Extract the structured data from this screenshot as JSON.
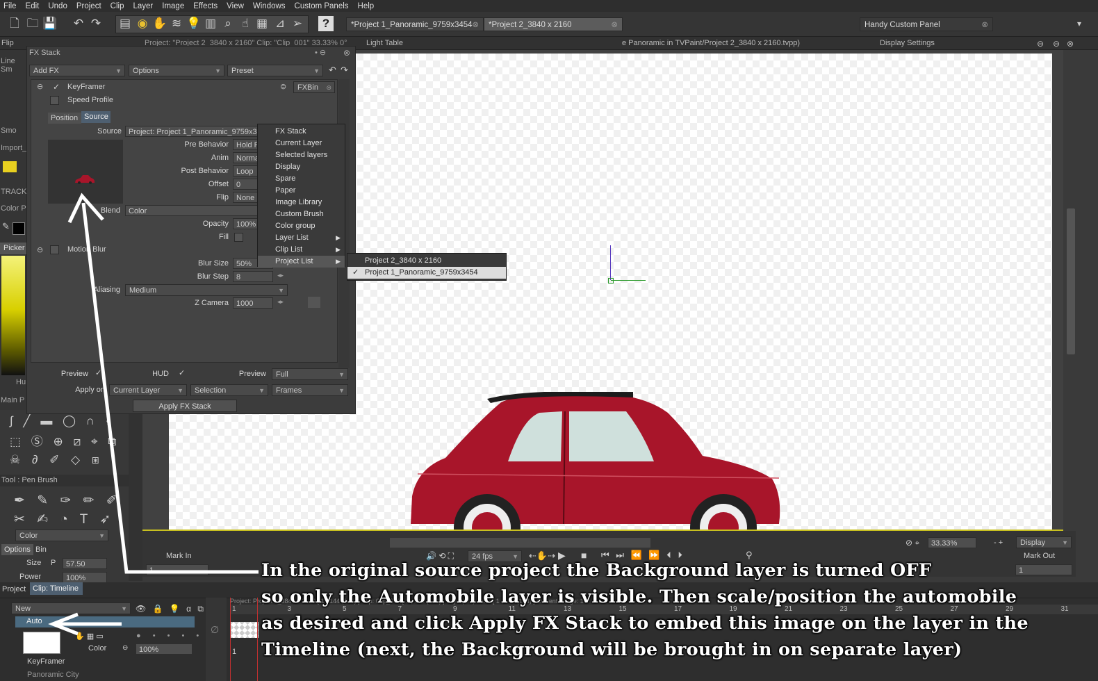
{
  "menu": [
    "File",
    "Edit",
    "Undo",
    "Project",
    "Clip",
    "Layer",
    "Image",
    "Effects",
    "View",
    "Windows",
    "Custom Panels",
    "Help"
  ],
  "tabs": [
    {
      "label": "*Project 1_Panoramic_9759x3454"
    },
    {
      "label": "*Project 2_3840 x 2160"
    }
  ],
  "handy_panel": "Handy Custom Panel",
  "panelbar": {
    "flip": "Flip",
    "project_info": "Project: \"Project 2_3840 x 2160\" Clip: \"Clip_001\" 33.33% 0°",
    "light_table": "Light Table",
    "path": "e Panoramic in TVPaint/Project 2_3840 x 2160.tvpp)",
    "display_settings": "Display Settings"
  },
  "left_labels": [
    "Line Sm",
    "Smo",
    "Import_",
    "TRACK",
    "Color P",
    "Picker",
    "Hu",
    "Main P"
  ],
  "fx_stack": {
    "title": "FX Stack",
    "add_fx": "Add FX",
    "options": "Options",
    "preset": "Preset",
    "keyframer": "KeyFramer",
    "fxbin": "FXBin",
    "speed_profile": "Speed Profile",
    "tab_position": "Position",
    "tab_source": "Source",
    "source_label": "Source",
    "source_value": "Project: Project 1_Panoramic_9759x3",
    "pre_behavior_label": "Pre Behavior",
    "pre_behavior_value": "Hold F",
    "anim_label": "Anim",
    "anim_value": "Norma",
    "post_behavior_label": "Post Behavior",
    "post_behavior_value": "Loop",
    "offset_label": "Offset",
    "offset_value": "0",
    "flip_label": "Flip",
    "flip_value": "None",
    "blend_label": "Blend",
    "blend_value": "Color",
    "opacity_label": "Opacity",
    "opacity_value": "100%",
    "fill_label": "Fill",
    "motion_blur": "Motion Blur",
    "blur_size_label": "Blur Size",
    "blur_size_value": "50%",
    "blur_step_label": "Blur Step",
    "blur_step_value": "8",
    "aliasing_label": "Aliasing",
    "aliasing_value": "Medium",
    "zcamera_label": "Z Camera",
    "zcamera_value": "1000",
    "preview_label": "Preview",
    "hud_label": "HUD",
    "preview2_label": "Preview",
    "preview2_value": "Full",
    "apply_on_label": "Apply on",
    "apply_on_value": "Current Layer",
    "selection_value": "Selection",
    "frames_value": "Frames",
    "apply_button": "Apply FX Stack"
  },
  "context_menu": [
    "FX Stack",
    "Current Layer",
    "Selected layers",
    "Display",
    "Spare",
    "Paper",
    "Image Library",
    "Custom Brush",
    "Color group",
    "Layer List",
    "Clip List",
    "Project List"
  ],
  "submenu": [
    "Project 2_3840 x 2160",
    "Project 1_Panoramic_9759x3454"
  ],
  "tool_panel": {
    "title": "Tool : Pen Brush",
    "color": "Color",
    "options_tab": "Options",
    "bin_tab": "Bin",
    "size_label": "Size",
    "size_p": "P",
    "size_value": "57.50",
    "power_label": "Power",
    "power_value": "100%"
  },
  "transport": {
    "mark_in": "Mark In",
    "mark_out": "Mark Out",
    "fps": "24 fps",
    "zoom": "33.33%",
    "display": "Display",
    "mark_out_value": "1",
    "mark_in_value": "1"
  },
  "timeline": {
    "project_tab": "Project",
    "clip_tab": "Clip: Timeline",
    "new_label": "New",
    "layer_mode": "Auto",
    "layer_name": "KeyFramer",
    "color_label": "Color",
    "opacity_value": "100%",
    "next_layer": "Panoramic City",
    "frame_numbers": [
      "1",
      "3",
      "5",
      "7",
      "9",
      "11",
      "13",
      "15",
      "17",
      "19",
      "21",
      "23",
      "25",
      "27",
      "29",
      "31"
    ],
    "status": "Project: Project 2_3840 x 2160 [ 1 , 144 (144) ]     Clip: Clip_001 [ 1 , 144 (144) ]     Layer(1/2): Auto [ 1 , 144 (144) ]     Current Image: 1"
  },
  "annotation": [
    "In the original source project the Background layer is turned OFF",
    "so only the Automobile layer is visible. Then scale/position the automobile",
    "as desired and click Apply FX Stack to embed this image on the layer in the",
    "Timeline  (next, the Background will be brought in on separate layer)"
  ],
  "colors": {
    "car": "#a8152a",
    "accent": "#5a5a5a",
    "annotation_text": "#ffffff"
  }
}
